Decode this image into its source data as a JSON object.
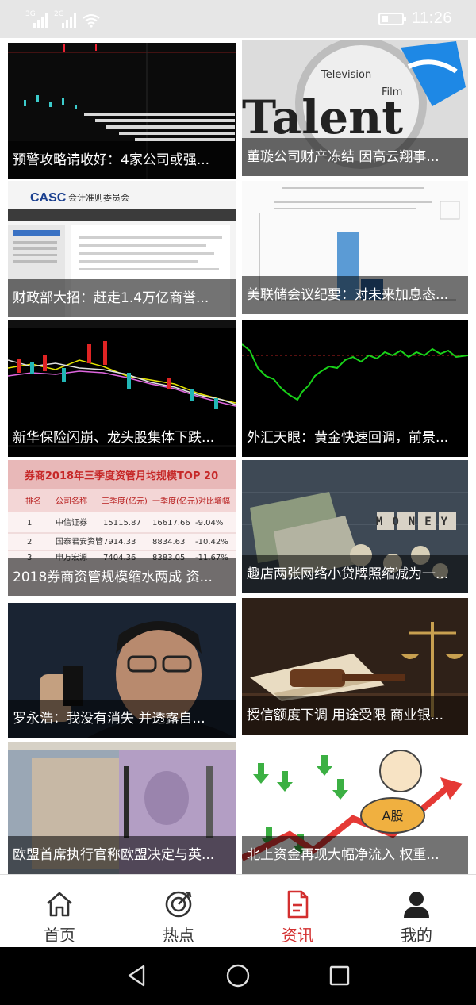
{
  "status_bar": {
    "sim1_tag": "3G",
    "sim2_tag": "2G",
    "time": "11:26"
  },
  "feed": {
    "cards": [
      {
        "title": "预警攻略请收好：4家公司或强..."
      },
      {
        "title": "董璇公司财产冻结 因高云翔事..."
      },
      {
        "title": "财政部大招：赶走1.4万亿商誉..."
      },
      {
        "title": "美联储会议纪要：对未来加息态..."
      },
      {
        "title": "新华保险闪崩、龙头股集体下跌..."
      },
      {
        "title": "外汇天眼：黄金快速回调，前景..."
      },
      {
        "title": "2018券商资管规模缩水两成 资..."
      },
      {
        "title": "趣店两张网络小贷牌照缩减为一..."
      },
      {
        "title": "罗永浩：我没有消失 并透露自..."
      },
      {
        "title": "授信额度下调 用途受限 商业银..."
      },
      {
        "title": "欧盟首席执行官称欧盟决定与英..."
      },
      {
        "title": "北上资金再现大幅净流入 权重..."
      }
    ],
    "image_text": {
      "talent_word": "Talent",
      "television_word": "Television",
      "film_word": "Film",
      "casc_logo": "CASC",
      "casc_name": "会计准则委员会",
      "brokerage_table_title": "券商2018年三季度资管月均规模TOP 20",
      "brokerage_table_headers": [
        "排名",
        "公司名称",
        "三季度(亿元)",
        "一季度(亿元)",
        "对比增幅"
      ],
      "brokerage_table_rows": [
        [
          "1",
          "中信证券",
          "15115.87",
          "16617.66",
          "-9.04%"
        ],
        [
          "2",
          "国泰君安资管",
          "7914.33",
          "8834.63",
          "-10.42%"
        ],
        [
          "3",
          "申万宏源",
          "7404.36",
          "8383.05",
          "-11.67%"
        ]
      ],
      "money_word": "MONEY",
      "a_share_label": "A股"
    }
  },
  "tabbar": {
    "tabs": [
      {
        "label": "首页",
        "icon": "home-icon",
        "active": false
      },
      {
        "label": "热点",
        "icon": "target-icon",
        "active": false
      },
      {
        "label": "资讯",
        "icon": "document-icon",
        "active": true
      },
      {
        "label": "我的",
        "icon": "person-icon",
        "active": false
      }
    ],
    "active_color": "#d32f2f"
  },
  "system_nav": {
    "buttons": [
      "back-icon",
      "home-circle-icon",
      "recents-icon"
    ]
  }
}
